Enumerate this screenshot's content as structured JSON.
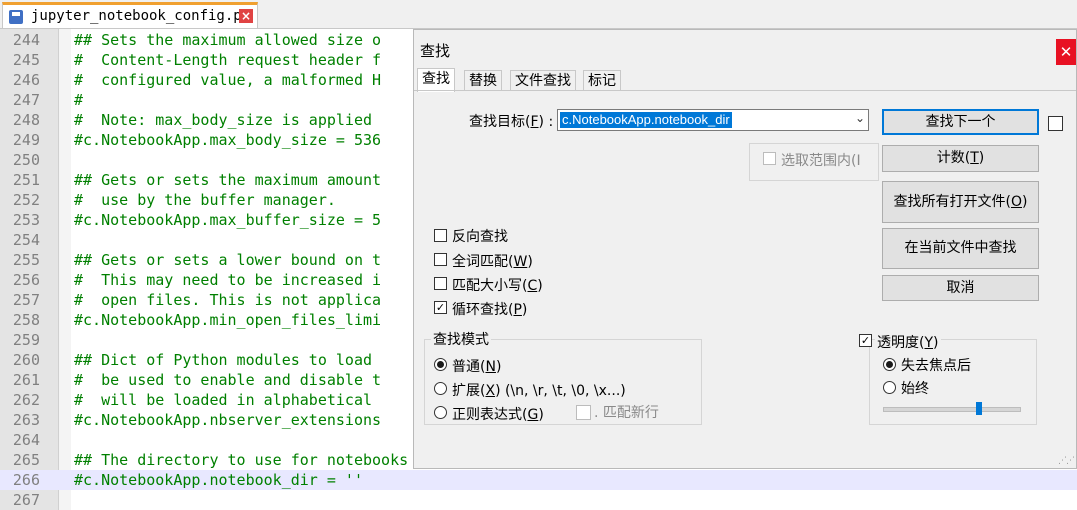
{
  "editor": {
    "tab_name": "jupyter_notebook_config.py",
    "lines": [
      {
        "num": "244",
        "code": "## Sets the maximum allowed size o"
      },
      {
        "num": "245",
        "code": "#  Content-Length request header f"
      },
      {
        "num": "246",
        "code": "#  configured value, a malformed H"
      },
      {
        "num": "247",
        "code": "#"
      },
      {
        "num": "248",
        "code": "#  Note: max_body_size is applied "
      },
      {
        "num": "249",
        "code": "#c.NotebookApp.max_body_size = 536"
      },
      {
        "num": "250",
        "code": ""
      },
      {
        "num": "251",
        "code": "## Gets or sets the maximum amount"
      },
      {
        "num": "252",
        "code": "#  use by the buffer manager."
      },
      {
        "num": "253",
        "code": "#c.NotebookApp.max_buffer_size = 5"
      },
      {
        "num": "254",
        "code": ""
      },
      {
        "num": "255",
        "code": "## Gets or sets a lower bound on t"
      },
      {
        "num": "256",
        "code": "#  This may need to be increased i"
      },
      {
        "num": "257",
        "code": "#  open files. This is not applica"
      },
      {
        "num": "258",
        "code": "#c.NotebookApp.min_open_files_limi"
      },
      {
        "num": "259",
        "code": ""
      },
      {
        "num": "260",
        "code": "## Dict of Python modules to load "
      },
      {
        "num": "261",
        "code": "#  be used to enable and disable t"
      },
      {
        "num": "262",
        "code": "#  will be loaded in alphabetical "
      },
      {
        "num": "263",
        "code": "#c.NotebookApp.nbserver_extensions"
      },
      {
        "num": "264",
        "code": ""
      },
      {
        "num": "265",
        "code": "## The directory to use for notebooks and kernels."
      },
      {
        "num": "266",
        "code": "#c.NotebookApp.notebook_dir = ''"
      },
      {
        "num": "267",
        "code": ""
      }
    ]
  },
  "dialog": {
    "title": "查找",
    "close_glyph": "✕",
    "tabs": [
      "查找",
      "替换",
      "文件查找",
      "标记"
    ],
    "find_label": "查找目标(",
    "find_label_key": "F",
    "find_label_end": ") :",
    "find_value": "c.NotebookApp.notebook_dir",
    "in_selection": {
      "label": "选取范围内(",
      "key": "I"
    },
    "buttons": {
      "find_next": "查找下一个",
      "count": "计数(",
      "count_key": "T",
      "find_all_open": "查找所有打开文件(",
      "find_all_open_key": "O",
      "find_in_current": "在当前文件中查找",
      "cancel": "取消",
      "close_paren": ")"
    },
    "options": [
      {
        "label": "反向查找",
        "key": "",
        "checked": false
      },
      {
        "label": "全词匹配(",
        "key": "W",
        "checked": false
      },
      {
        "label": "匹配大小写(",
        "key": "C",
        "checked": false
      },
      {
        "label": "循环查找(",
        "key": "P",
        "checked": true
      }
    ],
    "search_mode": {
      "title": "查找模式",
      "normal": "普通(",
      "normal_key": "N",
      "extended": "扩展(",
      "extended_key": "X",
      "extended_tail": ") (\\n, \\r, \\t, \\0, \\x...)",
      "regex": "正则表达式(",
      "regex_key": "G",
      "dot_newline": ". 匹配新行",
      "selected": "normal"
    },
    "transparency": {
      "label": "透明度(",
      "key": "Y",
      "checked": true,
      "on_lose_focus": "失去焦点后",
      "always": "始终",
      "selected": "on_lose_focus",
      "level": 0.7
    },
    "check_glyph": "✓"
  }
}
